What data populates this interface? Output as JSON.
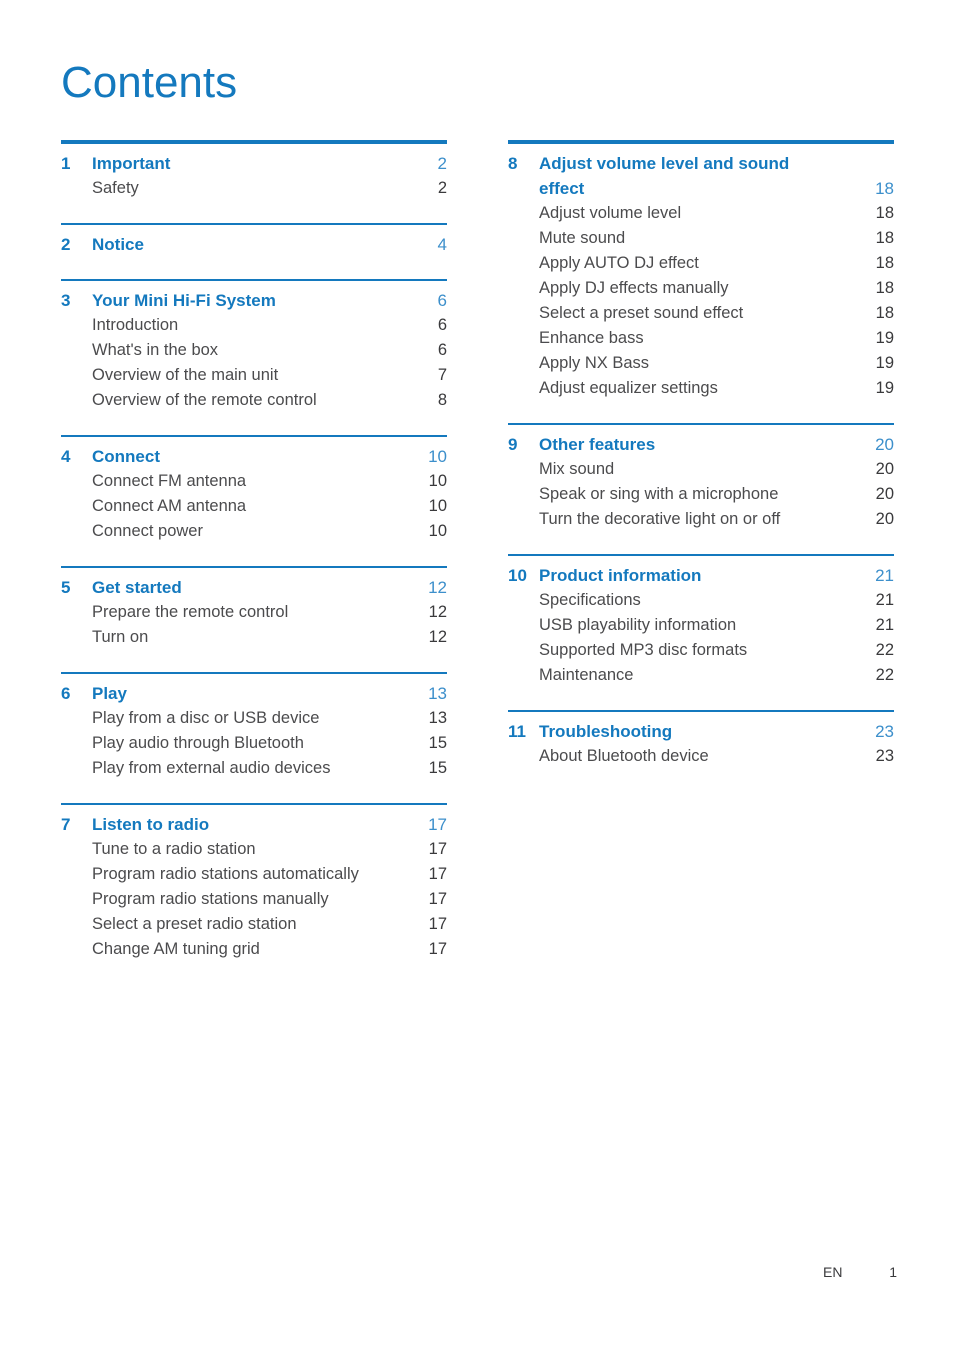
{
  "document": {
    "title": "Contents"
  },
  "footer": {
    "language": "EN",
    "page_number": "1"
  },
  "colors": {
    "heading_blue": "#1479BE",
    "rule_blue": "#1479BE",
    "chapter_page_blue": "#3C8FCB",
    "body_gray": "#4B4B4D"
  },
  "columns": {
    "left": [
      {
        "number": "1",
        "title": "Important",
        "page": "2",
        "rule": "thick",
        "items": [
          {
            "label": "Safety",
            "page": "2"
          }
        ]
      },
      {
        "number": "2",
        "title": "Notice",
        "page": "4",
        "rule": "thin",
        "items": []
      },
      {
        "number": "3",
        "title": "Your Mini Hi-Fi System",
        "page": "6",
        "rule": "thin",
        "items": [
          {
            "label": "Introduction",
            "page": "6"
          },
          {
            "label": "What's in the box",
            "page": "6"
          },
          {
            "label": "Overview of the main unit",
            "page": "7"
          },
          {
            "label": "Overview of the remote control",
            "page": "8"
          }
        ]
      },
      {
        "number": "4",
        "title": "Connect",
        "page": "10",
        "rule": "thin",
        "items": [
          {
            "label": "Connect FM antenna",
            "page": "10"
          },
          {
            "label": "Connect AM antenna",
            "page": "10"
          },
          {
            "label": "Connect power",
            "page": "10"
          }
        ]
      },
      {
        "number": "5",
        "title": "Get started",
        "page": "12",
        "rule": "thin",
        "items": [
          {
            "label": "Prepare the remote control",
            "page": "12"
          },
          {
            "label": "Turn on",
            "page": "12"
          }
        ]
      },
      {
        "number": "6",
        "title": "Play",
        "page": "13",
        "rule": "thin",
        "items": [
          {
            "label": "Play from a disc or USB device",
            "page": "13"
          },
          {
            "label": "Play audio through Bluetooth",
            "page": "15"
          },
          {
            "label": "Play from external audio devices",
            "page": "15"
          }
        ]
      },
      {
        "number": "7",
        "title": "Listen to radio",
        "page": "17",
        "rule": "thin",
        "items": [
          {
            "label": "Tune to a radio station",
            "page": "17"
          },
          {
            "label": "Program radio stations automatically",
            "page": "17"
          },
          {
            "label": "Program radio stations manually",
            "page": "17"
          },
          {
            "label": "Select a preset radio station",
            "page": "17"
          },
          {
            "label": "Change AM tuning grid",
            "page": "17"
          }
        ]
      }
    ],
    "right": [
      {
        "number": "8",
        "title": "Adjust volume level and sound",
        "title_line2": "effect",
        "page": "18",
        "rule": "thick",
        "items": [
          {
            "label": "Adjust volume level",
            "page": "18"
          },
          {
            "label": "Mute sound",
            "page": "18"
          },
          {
            "label": "Apply AUTO DJ effect",
            "page": "18"
          },
          {
            "label": "Apply DJ effects manually",
            "page": "18"
          },
          {
            "label": "Select a preset sound effect",
            "page": "18"
          },
          {
            "label": "Enhance bass",
            "page": "19"
          },
          {
            "label": "Apply NX Bass",
            "page": "19"
          },
          {
            "label": "Adjust equalizer settings",
            "page": "19"
          }
        ]
      },
      {
        "number": "9",
        "title": "Other features",
        "page": "20",
        "rule": "thin",
        "items": [
          {
            "label": "Mix sound",
            "page": "20"
          },
          {
            "label": "Speak or sing with a microphone",
            "page": "20"
          },
          {
            "label": "Turn the decorative light on or off",
            "page": "20"
          }
        ]
      },
      {
        "number": "10",
        "title": "Product information",
        "page": "21",
        "rule": "thin",
        "items": [
          {
            "label": "Specifications",
            "page": "21"
          },
          {
            "label": "USB playability information",
            "page": "21"
          },
          {
            "label": "Supported MP3 disc formats",
            "page": "22"
          },
          {
            "label": "Maintenance",
            "page": "22"
          }
        ]
      },
      {
        "number": "11",
        "title": "Troubleshooting",
        "page": "23",
        "rule": "thin",
        "items": [
          {
            "label": "About Bluetooth device",
            "page": "23"
          }
        ]
      }
    ]
  }
}
